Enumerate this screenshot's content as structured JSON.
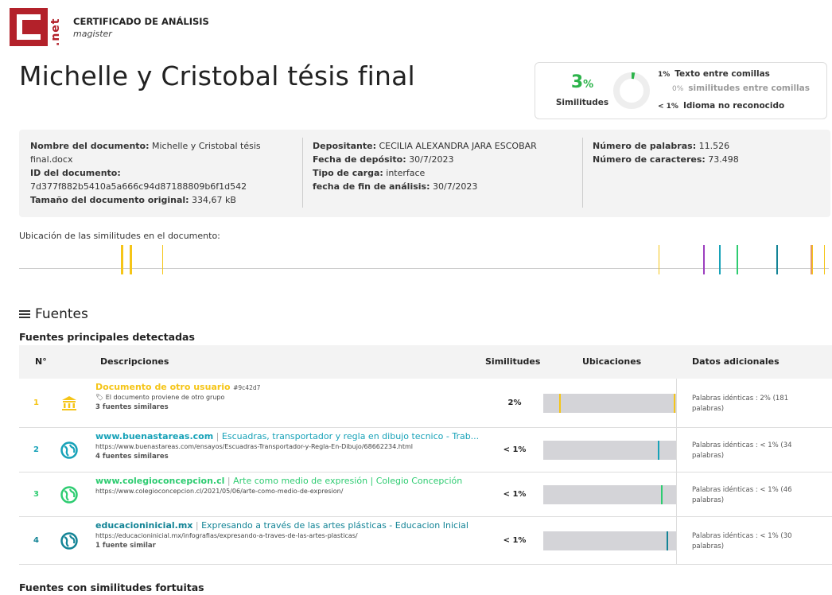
{
  "header": {
    "title": "CERTIFICADO DE ANÁLISIS",
    "subtitle": "magister",
    "logo_text": ".net"
  },
  "document_title": "Michelle y Cristobal tésis final",
  "similarity": {
    "percent": "3",
    "percent_sign": "%",
    "label": "Similitudes",
    "donut_fraction": 0.03,
    "rows": [
      {
        "pct": "1%",
        "text": "Texto entre comillas"
      },
      {
        "pct": "0%",
        "text": "similitudes entre comillas"
      },
      {
        "pct": "< 1%",
        "text": "Idioma no reconocido"
      }
    ]
  },
  "info": {
    "nombre_label": "Nombre del documento:",
    "nombre_value": "Michelle y Cristobal tésis final.docx",
    "id_label": "ID del documento:",
    "id_value": "7d377f882b5410a5a666c94d87188809b6f1d542",
    "tamano_label": "Tamaño del documento original:",
    "tamano_value": "334,67 kB",
    "depositante_label": "Depositante:",
    "depositante_value": "CECILIA ALEXANDRA JARA ESCOBAR",
    "fecha_deposito_label": "Fecha de depósito:",
    "fecha_deposito_value": "30/7/2023",
    "tipo_label": "Tipo de carga:",
    "tipo_value": "interface",
    "fecha_fin_label": "fecha de fin de análisis:",
    "fecha_fin_value": "30/7/2023",
    "palabras_label": "Número de palabras:",
    "palabras_value": "11.526",
    "caracteres_label": "Número de caracteres:",
    "caracteres_value": "73.498"
  },
  "location": {
    "label": "Ubicación de las similitudes en el documento:",
    "marks": [
      {
        "pos": 0.126,
        "color": "#f5c518",
        "width": 3
      },
      {
        "pos": 0.137,
        "color": "#f5c518",
        "width": 3
      },
      {
        "pos": 0.177,
        "color": "#f5c518",
        "width": 1
      },
      {
        "pos": 0.791,
        "color": "#f5c518",
        "width": 1
      },
      {
        "pos": 0.846,
        "color": "#9c3fbf",
        "width": 2
      },
      {
        "pos": 0.866,
        "color": "#17a2b8",
        "width": 2
      },
      {
        "pos": 0.888,
        "color": "#2ecc71",
        "width": 2
      },
      {
        "pos": 0.937,
        "color": "#138496",
        "width": 2
      },
      {
        "pos": 0.979,
        "color": "#e59866",
        "width": 3
      },
      {
        "pos": 0.981,
        "color": "#f5c518",
        "width": 1
      },
      {
        "pos": 0.996,
        "color": "#f5c518",
        "width": 1
      }
    ]
  },
  "fuentes": {
    "heading": "Fuentes",
    "principales_heading": "Fuentes principales detectadas",
    "fortuitas_heading": "Fuentes con similitudes fortuitas",
    "columns": {
      "num": "N°",
      "desc": "Descripciones",
      "sim": "Similitudes",
      "ubic": "Ubicaciones",
      "datos": "Datos adicionales"
    },
    "rows": [
      {
        "num": "1",
        "icon": "institution-icon",
        "title_main": "Documento de otro usuario",
        "title_sep": "",
        "title_rest": "",
        "tag": "#9c42d7",
        "title_color": "#f5c518",
        "line2": "🏷 El documento proviene de otro grupo",
        "line3": "3 fuentes similares",
        "sim": "2%",
        "marks": [
          {
            "pos": 0.12,
            "color": "#f5c518"
          },
          {
            "pos": 0.99,
            "color": "#f5c518"
          }
        ],
        "datos": "Palabras idénticas : 2% (181 palabras)"
      },
      {
        "num": "2",
        "icon": "globe-icon",
        "title_main": "www.buenastareas.com",
        "title_sep": " | ",
        "title_rest": "Escuadras, transportador y regla en dibujo tecnico - Trab...",
        "tag": "",
        "title_color": "#17a2b8",
        "line2": "https://www.buenastareas.com/ensayos/Escuadras-Transportador-y-Regla-En-Dibujo/68662234.html",
        "line3": "4 fuentes similares",
        "sim": "< 1%",
        "marks": [
          {
            "pos": 0.87,
            "color": "#17a2b8"
          }
        ],
        "datos": "Palabras idénticas : < 1% (34 palabras)"
      },
      {
        "num": "3",
        "icon": "globe-icon",
        "title_main": "www.colegioconcepcion.cl",
        "title_sep": " | ",
        "title_rest": "Arte como medio de expresión | Colegio Concepción",
        "tag": "",
        "title_color": "#2ecc71",
        "line2": "https://www.colegioconcepcion.cl/2021/05/06/arte-como-medio-de-expresion/",
        "line3": "",
        "sim": "< 1%",
        "marks": [
          {
            "pos": 0.89,
            "color": "#2ecc71"
          }
        ],
        "datos": "Palabras idénticas : < 1% (46 palabras)"
      },
      {
        "num": "4",
        "icon": "globe-icon",
        "title_main": "educacioninicial.mx",
        "title_sep": " | ",
        "title_rest": "Expresando a través de las artes plásticas - Educacion Inicial",
        "tag": "",
        "title_color": "#138496",
        "line2": "https://educacioninicial.mx/infografias/expresando-a-traves-de-las-artes-plasticas/",
        "line3": "1 fuente similar",
        "sim": "< 1%",
        "marks": [
          {
            "pos": 0.935,
            "color": "#138496"
          }
        ],
        "datos": "Palabras idénticas : < 1% (30 palabras)"
      }
    ]
  }
}
